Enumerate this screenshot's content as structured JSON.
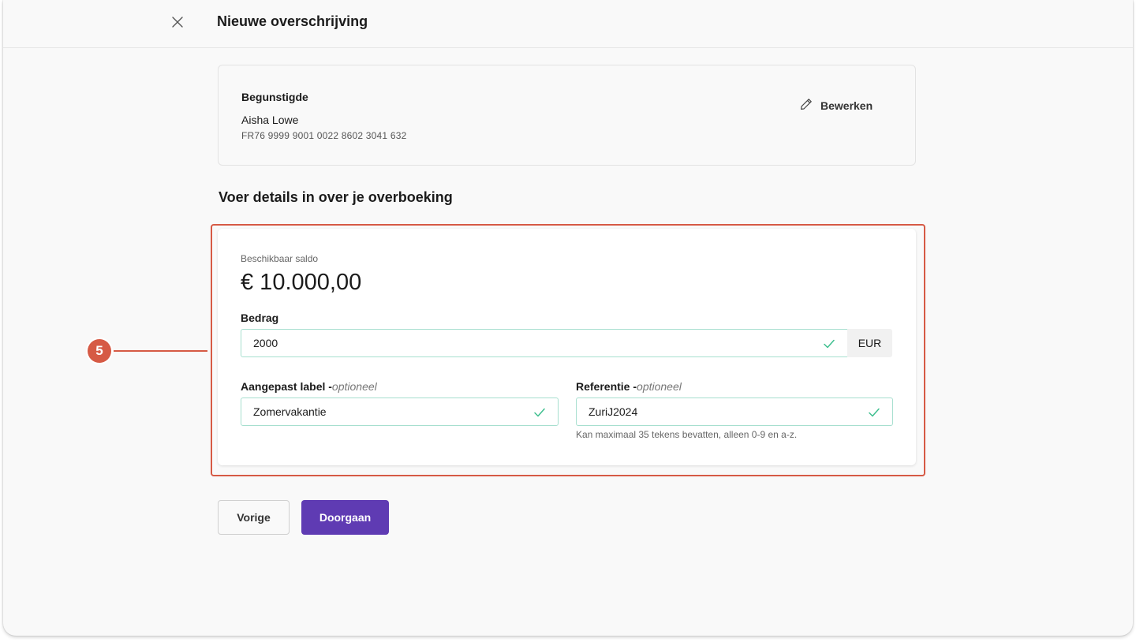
{
  "header": {
    "title": "Nieuwe overschrijving",
    "close_icon": "close-icon"
  },
  "beneficiary": {
    "heading": "Begunstigde",
    "name": "Aisha Lowe",
    "iban": "FR76 9999 9001 0022 8602 3041 632",
    "edit_label": "Bewerken",
    "edit_icon": "pencil-icon"
  },
  "section_title": "Voer details in over je overboeking",
  "balance": {
    "label": "Beschikbaar saldo",
    "value": "€ 10.000,00"
  },
  "amount": {
    "label": "Bedrag",
    "value": "2000",
    "currency": "EUR"
  },
  "custom_label": {
    "label": "Aangepast label -",
    "optional": "optioneel",
    "value": "Zomervakantie"
  },
  "reference": {
    "label": "Referentie -",
    "optional": "optioneel",
    "value": "ZuriJ2024",
    "hint": "Kan maximaal 35 tekens bevatten, alleen 0-9 en a-z."
  },
  "buttons": {
    "previous": "Vorige",
    "continue": "Doorgaan"
  },
  "annotation": {
    "step": "5"
  },
  "colors": {
    "primary": "#5f3bb3",
    "highlight": "#d65a45",
    "valid_border": "#a7dfcf",
    "check": "#3fbf8f"
  }
}
